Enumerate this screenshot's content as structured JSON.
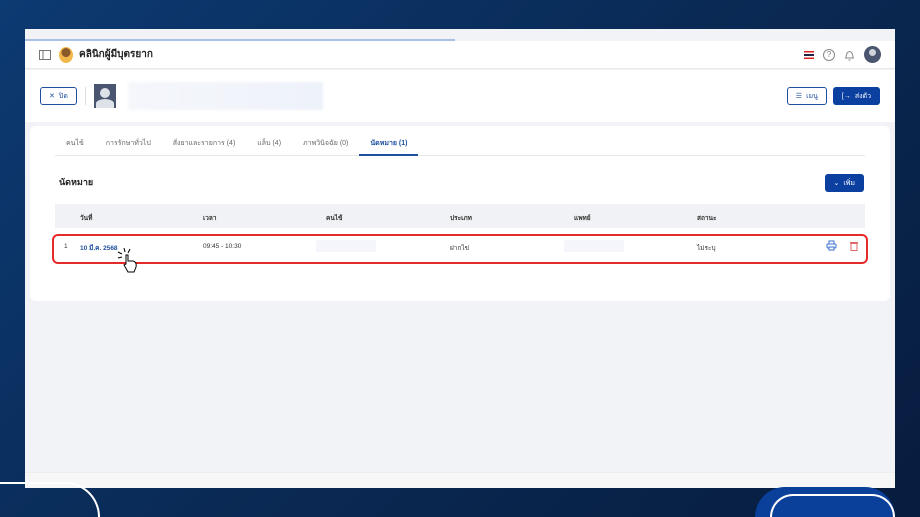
{
  "header": {
    "clinic_name": "คลินิกผู้มีบุตรยาก"
  },
  "toolbar": {
    "close_label": "ปิด",
    "menu_label": "เมนู",
    "refer_label": "ส่งตัว"
  },
  "tabs": [
    {
      "label": "คนไข้"
    },
    {
      "label": "การรักษาทั่วไป"
    },
    {
      "label": "สั่งยาและรายการ (4)"
    },
    {
      "label": "แล็บ (4)"
    },
    {
      "label": "ภาพวินิจฉัย (0)"
    },
    {
      "label": "นัดหมาย (1)",
      "active": true
    }
  ],
  "section": {
    "title": "นัดหมาย",
    "add_label": "เพิ่ม"
  },
  "table": {
    "headers": [
      "วันที่",
      "เวลา",
      "คนไข้",
      "ประเภท",
      "แพทย์",
      "สถานะ"
    ],
    "rows": [
      {
        "index": "1",
        "date": "10 มี.ค. 2568",
        "time": "09:45 - 10:30",
        "type": "ฝากไข่",
        "status": "ไม่ระบุ"
      }
    ]
  },
  "colors": {
    "primary": "#0b3fa0",
    "highlight": "#e52a2a"
  }
}
